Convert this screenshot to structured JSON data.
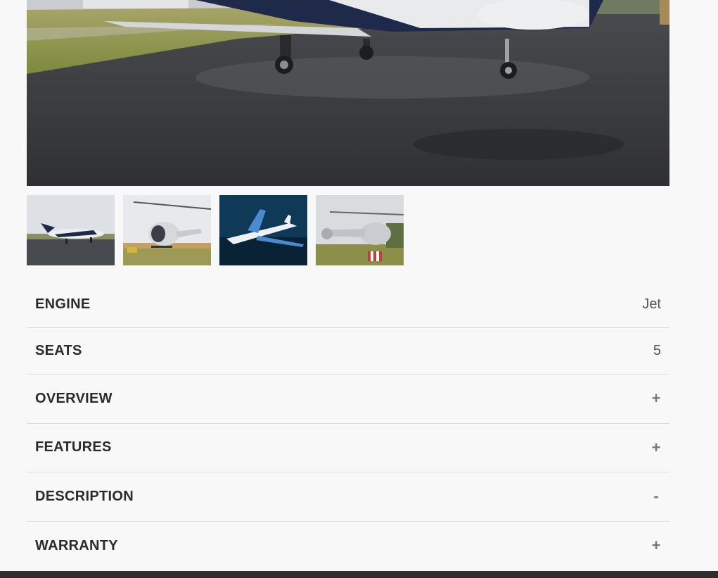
{
  "gallery": {
    "main_image": "jet-on-wet-tarmac-photo",
    "thumbnails": [
      {
        "image": "jet-on-tarmac-thumbnail"
      },
      {
        "image": "helicopter-on-grass-thumbnail"
      },
      {
        "image": "jet-in-flight-thumbnail"
      },
      {
        "image": "helicopter-hovering-thumbnail"
      }
    ]
  },
  "specs": [
    {
      "label": "ENGINE",
      "value": "Jet"
    },
    {
      "label": "SEATS",
      "value": "5"
    }
  ],
  "accordion": [
    {
      "label": "OVERVIEW",
      "toggle": "+"
    },
    {
      "label": "FEATURES",
      "toggle": "+"
    },
    {
      "label": "DESCRIPTION",
      "toggle": "-"
    },
    {
      "label": "WARRANTY",
      "toggle": "+"
    }
  ],
  "colors": {
    "background": "#f8f8f8",
    "divider": "#dcdcdc",
    "label_text": "#2b2b2b",
    "footer": "#2e2e2e"
  }
}
